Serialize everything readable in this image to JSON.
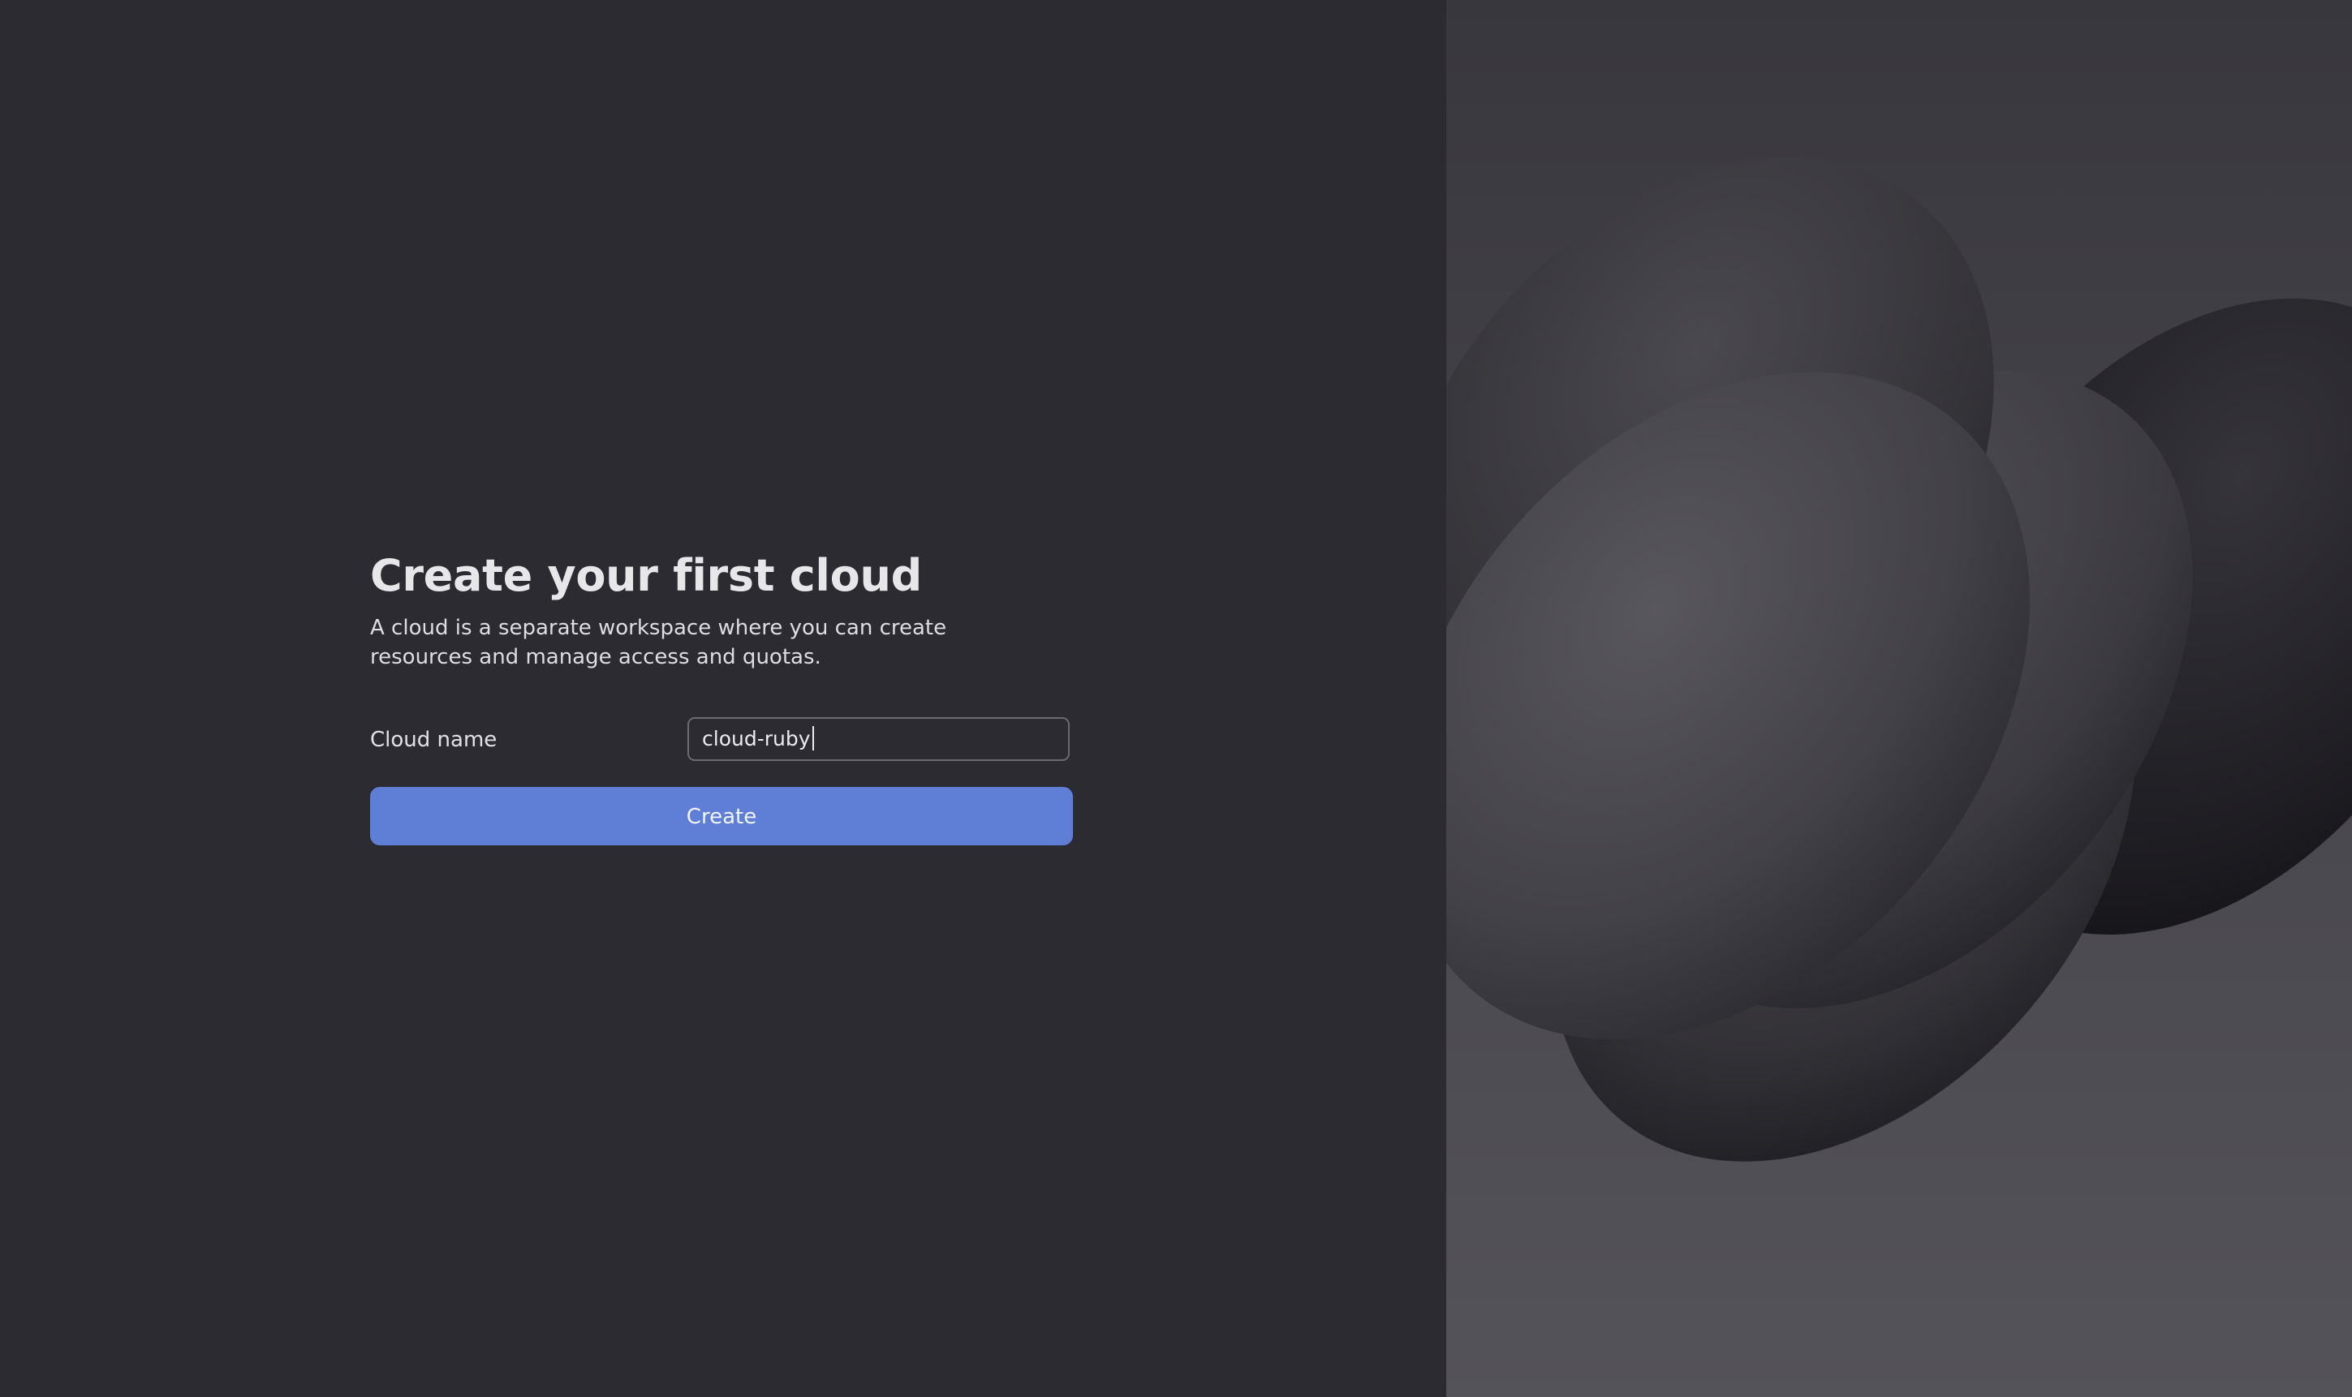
{
  "form": {
    "title": "Create your first cloud",
    "description": "A cloud is a separate workspace where you can create resources and manage access and quotas.",
    "cloud_name_label": "Cloud name",
    "cloud_name_value": "cloud-ruby",
    "create_label": "Create"
  },
  "colors": {
    "background": "#2c2b31",
    "accent": "#5f7ed6",
    "text": "#e7e7ea"
  }
}
